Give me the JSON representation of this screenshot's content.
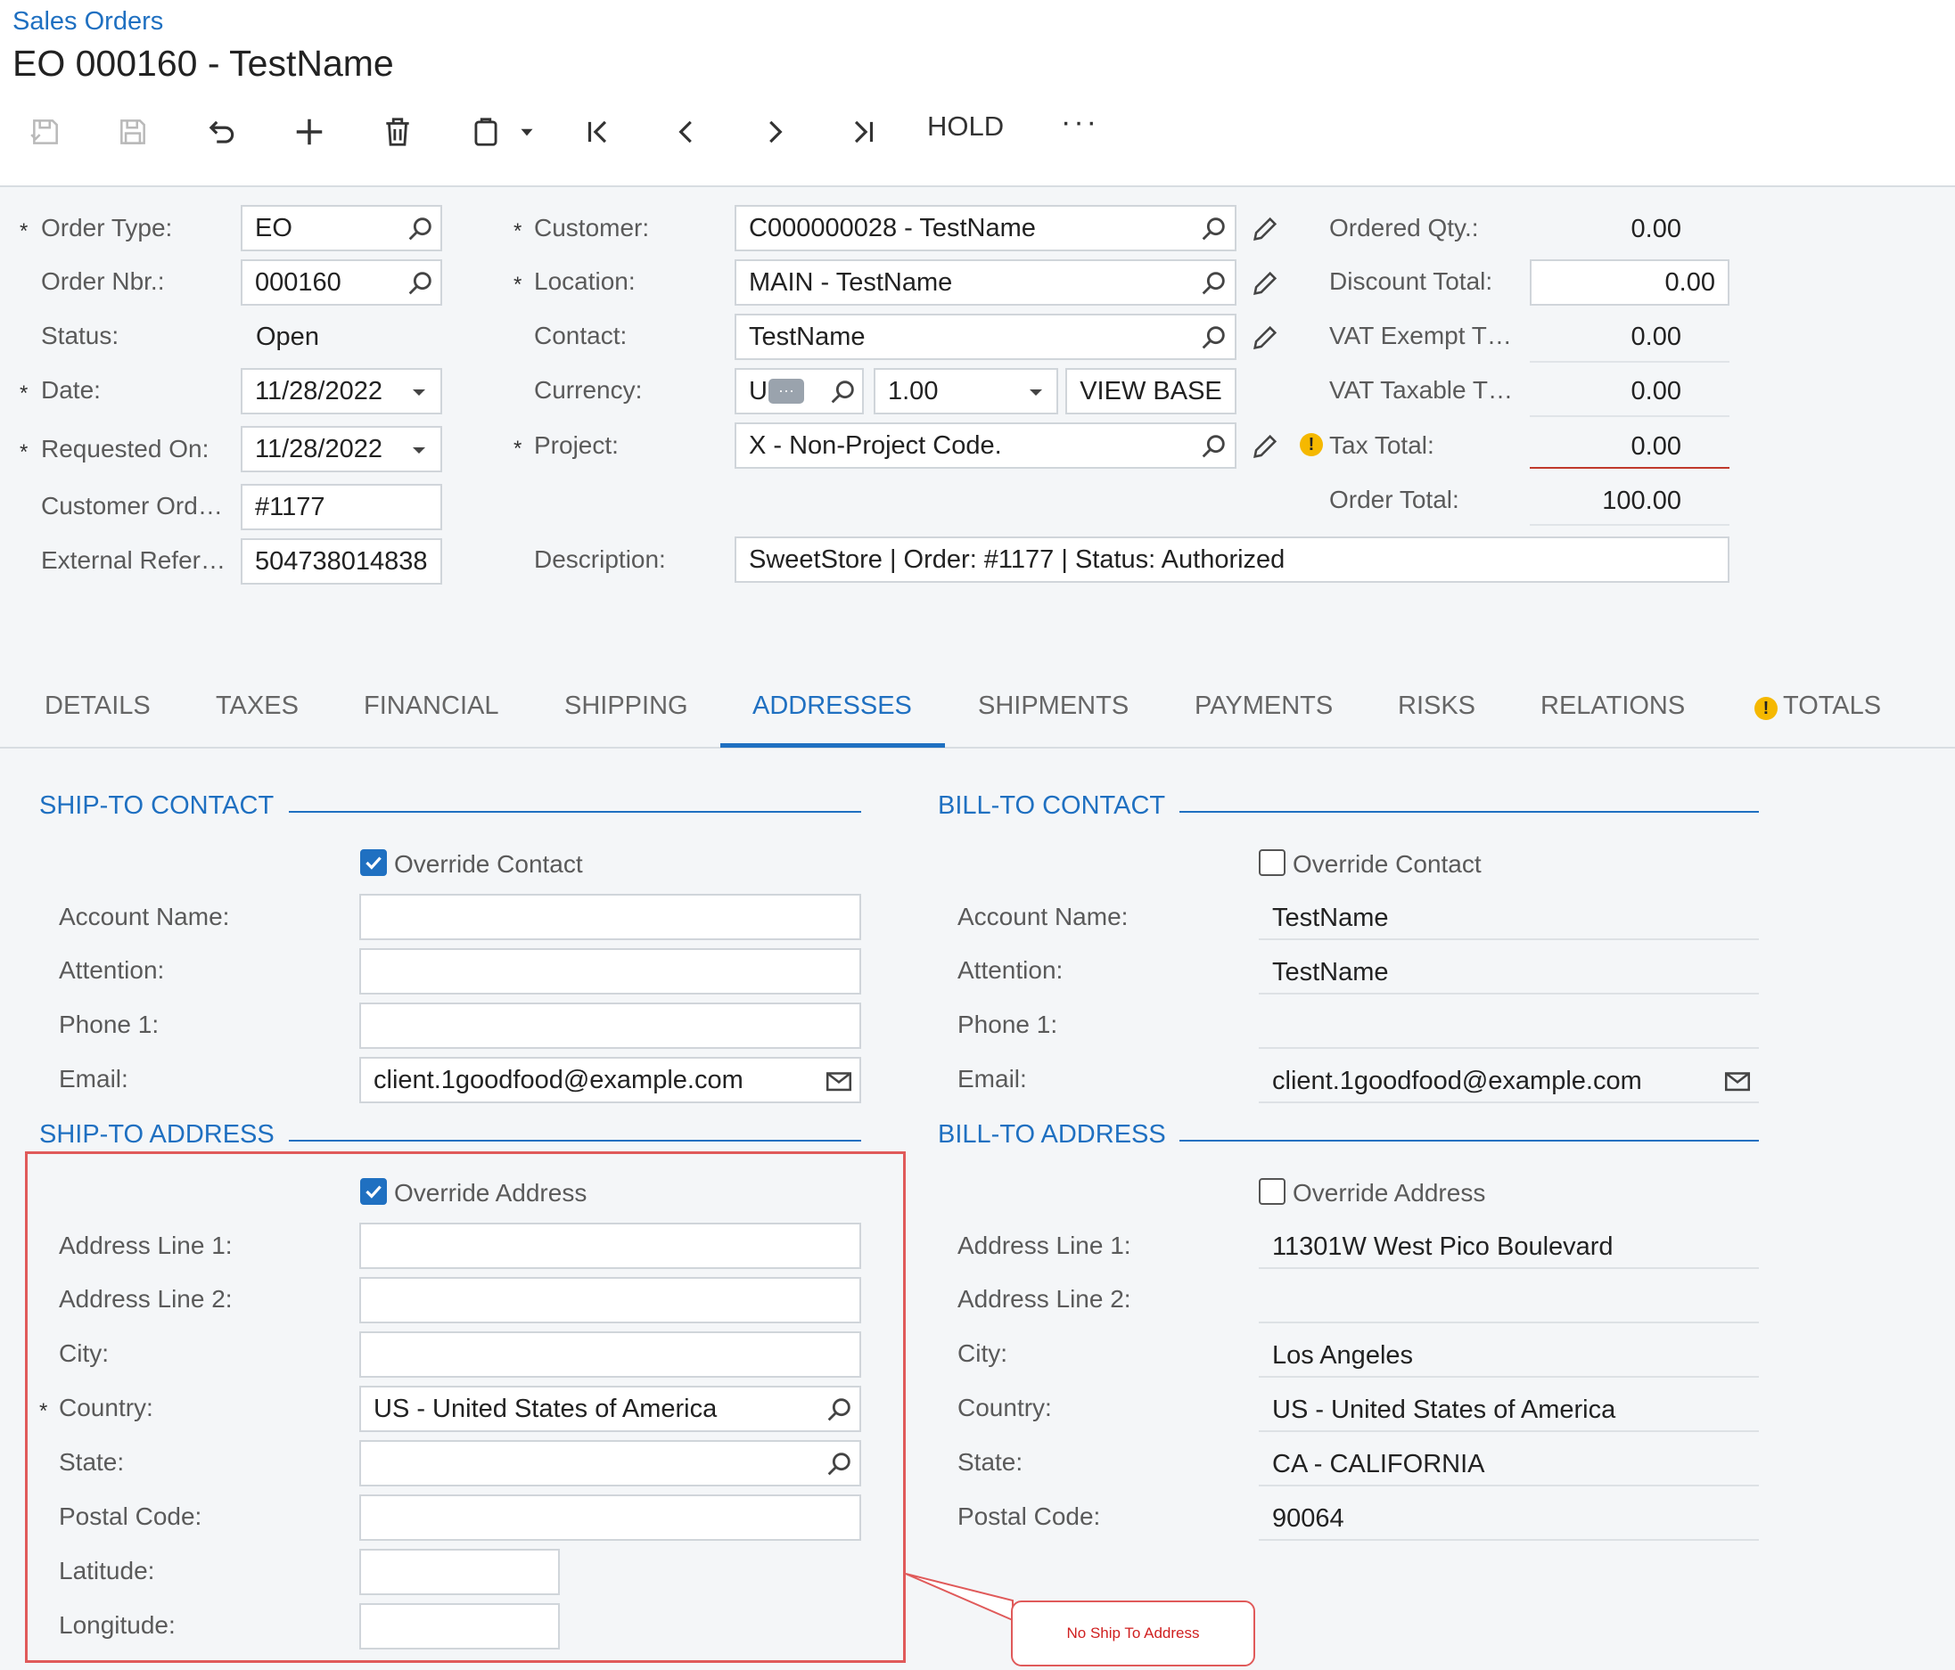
{
  "breadcrumb": "Sales Orders",
  "title": "EO 000160 - TestName",
  "toolbar": {
    "hold_label": "HOLD",
    "more_label": "···"
  },
  "summary": {
    "order_type": {
      "label": "Order Type:",
      "value": "EO"
    },
    "order_nbr": {
      "label": "Order Nbr.:",
      "value": "000160"
    },
    "status": {
      "label": "Status:",
      "value": "Open"
    },
    "date": {
      "label": "Date:",
      "value": "11/28/2022"
    },
    "requested_on": {
      "label": "Requested On:",
      "value": "11/28/2022"
    },
    "customer_ord": {
      "label": "Customer Ord…",
      "value": "#1177"
    },
    "external_ref": {
      "label": "External Refer…",
      "value": "504738014838"
    },
    "customer": {
      "label": "Customer:",
      "value": "C000000028 - TestName"
    },
    "location": {
      "label": "Location:",
      "value": "MAIN - TestName"
    },
    "contact": {
      "label": "Contact:",
      "value": "TestName"
    },
    "currency": {
      "label": "Currency:",
      "value": "U",
      "rate": "1.00",
      "view_base": "VIEW BASE"
    },
    "project": {
      "label": "Project:",
      "value": "X - Non-Project Code."
    },
    "description": {
      "label": "Description:",
      "value": "SweetStore | Order: #1177 | Status: Authorized"
    },
    "ordered_qty": {
      "label": "Ordered Qty.:",
      "value": "0.00"
    },
    "discount_total": {
      "label": "Discount Total:",
      "value": "0.00"
    },
    "vat_exempt": {
      "label": "VAT Exempt T…",
      "value": "0.00"
    },
    "vat_taxable": {
      "label": "VAT Taxable T…",
      "value": "0.00"
    },
    "tax_total": {
      "label": "Tax Total:",
      "value": "0.00"
    },
    "order_total": {
      "label": "Order Total:",
      "value": "100.00"
    }
  },
  "tabs": [
    "DETAILS",
    "TAXES",
    "FINANCIAL",
    "SHIPPING",
    "ADDRESSES",
    "SHIPMENTS",
    "PAYMENTS",
    "RISKS",
    "RELATIONS",
    "TOTALS"
  ],
  "ship_contact": {
    "heading": "SHIP-TO CONTACT",
    "override_label": "Override Contact",
    "account_name": {
      "label": "Account Name:",
      "value": ""
    },
    "attention": {
      "label": "Attention:",
      "value": ""
    },
    "phone1": {
      "label": "Phone 1:",
      "value": ""
    },
    "email": {
      "label": "Email:",
      "value": "client.1goodfood@example.com"
    }
  },
  "bill_contact": {
    "heading": "BILL-TO CONTACT",
    "override_label": "Override Contact",
    "account_name": {
      "label": "Account Name:",
      "value": "TestName"
    },
    "attention": {
      "label": "Attention:",
      "value": "TestName"
    },
    "phone1": {
      "label": "Phone 1:",
      "value": ""
    },
    "email": {
      "label": "Email:",
      "value": "client.1goodfood@example.com"
    }
  },
  "ship_address": {
    "heading": "SHIP-TO ADDRESS",
    "override_label": "Override Address",
    "line1": {
      "label": "Address Line 1:",
      "value": ""
    },
    "line2": {
      "label": "Address Line 2:",
      "value": ""
    },
    "city": {
      "label": "City:",
      "value": ""
    },
    "country": {
      "label": "Country:",
      "value": "US - United States of America"
    },
    "state": {
      "label": "State:",
      "value": ""
    },
    "postal": {
      "label": "Postal Code:",
      "value": ""
    },
    "latitude": {
      "label": "Latitude:",
      "value": ""
    },
    "longitude": {
      "label": "Longitude:",
      "value": ""
    }
  },
  "bill_address": {
    "heading": "BILL-TO ADDRESS",
    "override_label": "Override Address",
    "line1": {
      "label": "Address Line 1:",
      "value": "11301W West Pico Boulevard"
    },
    "line2": {
      "label": "Address Line 2:",
      "value": ""
    },
    "city": {
      "label": "City:",
      "value": "Los Angeles"
    },
    "country": {
      "label": "Country:",
      "value": "US - United States of America"
    },
    "state": {
      "label": "State:",
      "value": "CA - CALIFORNIA"
    },
    "postal": {
      "label": "Postal Code:",
      "value": "90064"
    }
  },
  "annotation": "No Ship To Address",
  "colors": {
    "accent": "#1f70c1",
    "annotation": "#e05a5a",
    "warning": "#f5b800"
  }
}
